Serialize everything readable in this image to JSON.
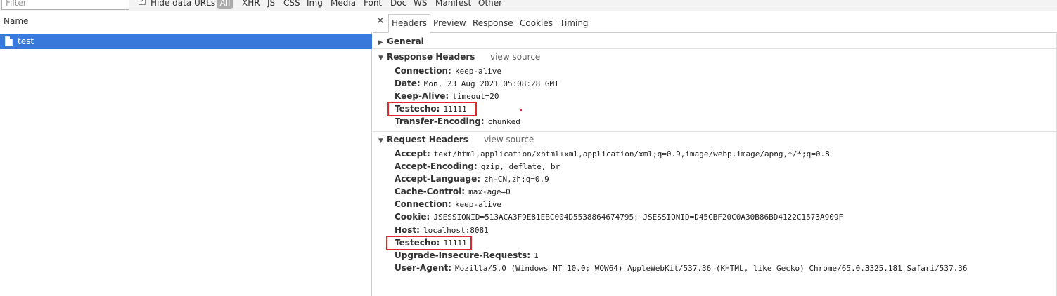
{
  "filterbar": {
    "filter_placeholder": "Filter",
    "hide_data_urls_label": "Hide data URLs",
    "hide_data_urls_checked": true,
    "types": [
      "All",
      "XHR",
      "JS",
      "CSS",
      "Img",
      "Media",
      "Font",
      "Doc",
      "WS",
      "Manifest",
      "Other"
    ],
    "active_type": "All"
  },
  "requests": {
    "column_header": "Name",
    "items": [
      {
        "name": "test",
        "selected": true
      }
    ]
  },
  "details": {
    "tabs": [
      "Headers",
      "Preview",
      "Response",
      "Cookies",
      "Timing"
    ],
    "active_tab": "Headers",
    "general": {
      "title": "General",
      "expanded": false
    },
    "response_headers": {
      "title": "Response Headers",
      "view_source": "view source",
      "expanded": true,
      "items": [
        {
          "key": "Connection:",
          "value": "keep-alive"
        },
        {
          "key": "Date:",
          "value": "Mon, 23 Aug 2021 05:08:28 GMT"
        },
        {
          "key": "Keep-Alive:",
          "value": "timeout=20"
        },
        {
          "key": "Testecho:",
          "value": "11111",
          "highlighted": true
        },
        {
          "key": "Transfer-Encoding:",
          "value": "chunked"
        }
      ]
    },
    "request_headers": {
      "title": "Request Headers",
      "view_source": "view source",
      "expanded": true,
      "items": [
        {
          "key": "Accept:",
          "value": "text/html,application/xhtml+xml,application/xml;q=0.9,image/webp,image/apng,*/*;q=0.8"
        },
        {
          "key": "Accept-Encoding:",
          "value": "gzip, deflate, br"
        },
        {
          "key": "Accept-Language:",
          "value": "zh-CN,zh;q=0.9"
        },
        {
          "key": "Cache-Control:",
          "value": "max-age=0"
        },
        {
          "key": "Connection:",
          "value": "keep-alive"
        },
        {
          "key": "Cookie:",
          "value": "JSESSIONID=513ACA3F9E81EBC004D5538864674795; JSESSIONID=D45CBF20C0A30B86BD4122C1573A909F"
        },
        {
          "key": "Host:",
          "value": "localhost:8081"
        },
        {
          "key": "Testecho:",
          "value": "11111",
          "highlighted": true
        },
        {
          "key": "Upgrade-Insecure-Requests:",
          "value": "1"
        },
        {
          "key": "User-Agent:",
          "value": "Mozilla/5.0 (Windows NT 10.0; WOW64) AppleWebKit/537.36 (KHTML, like Gecko) Chrome/65.0.3325.181 Safari/537.36"
        }
      ]
    }
  },
  "colors": {
    "selection": "#3879d9",
    "highlight_box": "#e0282e"
  }
}
